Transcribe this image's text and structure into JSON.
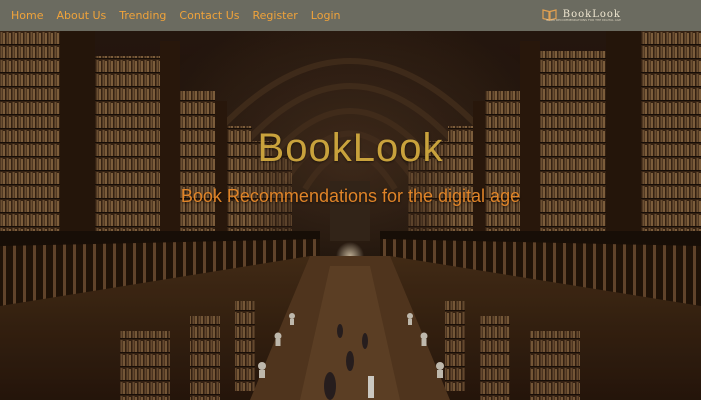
{
  "nav": {
    "links": [
      "Home",
      "About Us",
      "Trending",
      "Contact Us",
      "Register",
      "Login"
    ]
  },
  "logo": {
    "name": "BookLook",
    "tagline": "BOOK RECOMMENDATIONS FOR THE DIGITAL AGE",
    "icon": "open-book-icon"
  },
  "hero": {
    "title": "BookLook",
    "subtitle": "Book Recommendations for the digital age",
    "background": "library-hall-photo"
  },
  "colors": {
    "nav_bg": "#6b6b60",
    "nav_link": "#f0a33a",
    "title": "#c9a23c",
    "subtitle": "#e08428"
  }
}
